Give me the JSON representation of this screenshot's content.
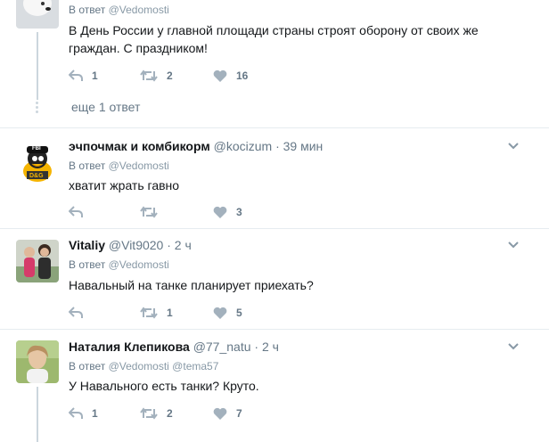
{
  "tweets": [
    {
      "reply_prefix": "В ответ",
      "reply_mention": "@Vedomosti",
      "text": "В День России у главной площади страны строят оборону от своих же граждан. С праздником!",
      "replies": "1",
      "retweets": "2",
      "likes": "16"
    },
    {
      "name": "эчпочмак и комбикорм",
      "handle": "@kocizum",
      "time": "39 мин",
      "reply_prefix": "В ответ",
      "reply_mention": "@Vedomosti",
      "text": "хватит жрать гавно",
      "replies": "",
      "retweets": "",
      "likes": "3"
    },
    {
      "name": "Vitaliy",
      "handle": "@Vit9020",
      "time": "2 ч",
      "reply_prefix": "В ответ",
      "reply_mention": "@Vedomosti",
      "text": "Навальный на танке планирует приехать?",
      "replies": "",
      "retweets": "1",
      "likes": "5"
    },
    {
      "name": "Наталия Клепикова",
      "handle": "@77_natu",
      "time": "2 ч",
      "reply_prefix": "В ответ",
      "reply_mention": "@Vedomosti",
      "reply_mention2": "@tema57",
      "text": "У Навального есть танки? Круто.",
      "replies": "1",
      "retweets": "2",
      "likes": "7"
    }
  ],
  "more_replies": "еще 1 ответ",
  "separator": "·",
  "avatar2_badge": "D&G",
  "avatar2_cap": "FBI",
  "colors": {
    "icon": "#a3b1bd",
    "text_secondary": "#657786",
    "divider": "#e6ecf0"
  }
}
